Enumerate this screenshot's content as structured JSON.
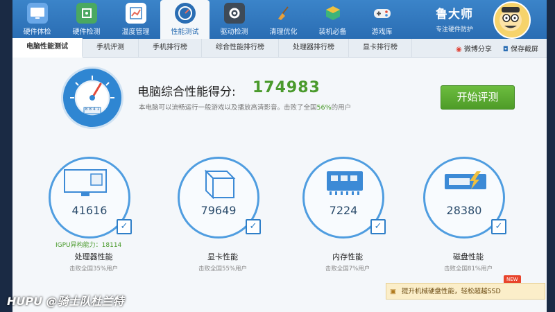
{
  "nav": {
    "items": [
      {
        "label": "硬件体检",
        "icon": "monitor-icon",
        "color": "#6aa8e8"
      },
      {
        "label": "硬件检测",
        "icon": "chip-icon",
        "color": "#4aa861"
      },
      {
        "label": "温度管理",
        "icon": "thermometer-icon",
        "color": "#e66b5b"
      },
      {
        "label": "性能测试",
        "icon": "speedometer-icon",
        "color": "#2a6db3",
        "active": true
      },
      {
        "label": "驱动检测",
        "icon": "gear-icon",
        "color": "#3e4a57"
      },
      {
        "label": "清理优化",
        "icon": "broom-icon",
        "color": "#e9a13a"
      },
      {
        "label": "装机必备",
        "icon": "box-icon",
        "color": "#3db37a"
      },
      {
        "label": "游戏库",
        "icon": "gamepad-icon",
        "color": "#e8e8e8"
      }
    ]
  },
  "brand": {
    "title": "鲁大师",
    "subtitle": "专注硬件防护"
  },
  "tabs": [
    {
      "label": "电脑性能测试",
      "active": true
    },
    {
      "label": "手机评测"
    },
    {
      "label": "手机排行榜"
    },
    {
      "label": "综合性能排行榜"
    },
    {
      "label": "处理器排行榜"
    },
    {
      "label": "显卡排行榜"
    }
  ],
  "tab_actions": {
    "share": "微博分享",
    "screenshot": "保存截屏"
  },
  "gauge": {
    "value_text": "8 8 4 1"
  },
  "score": {
    "title": "电脑综合性能得分:",
    "value": "174983",
    "desc_prefix": "本电脑可以流畅运行一般游戏以及播放高清影音。击败了全国",
    "percent": "56%",
    "desc_suffix": "的用户"
  },
  "start_button": "开始评测",
  "cards": [
    {
      "value": "41616",
      "title": "处理器性能",
      "sub": "击败全国35%用户",
      "icon": "cpu-monitor-icon"
    },
    {
      "value": "79649",
      "title": "显卡性能",
      "sub": "击败全国55%用户",
      "icon": "graphics-cube-icon"
    },
    {
      "value": "7224",
      "title": "内存性能",
      "sub": "击败全国7%用户",
      "icon": "memory-chip-icon"
    },
    {
      "value": "28380",
      "title": "磁盘性能",
      "sub": "击败全国81%用户",
      "icon": "disk-drive-icon"
    }
  ],
  "igpu": "IGPU异构能力：18114",
  "promo": {
    "text": "提升机械硬盘性能，轻松超越SSD",
    "badge": "NEW"
  },
  "watermark": "HUPU @骑士队杜兰特"
}
